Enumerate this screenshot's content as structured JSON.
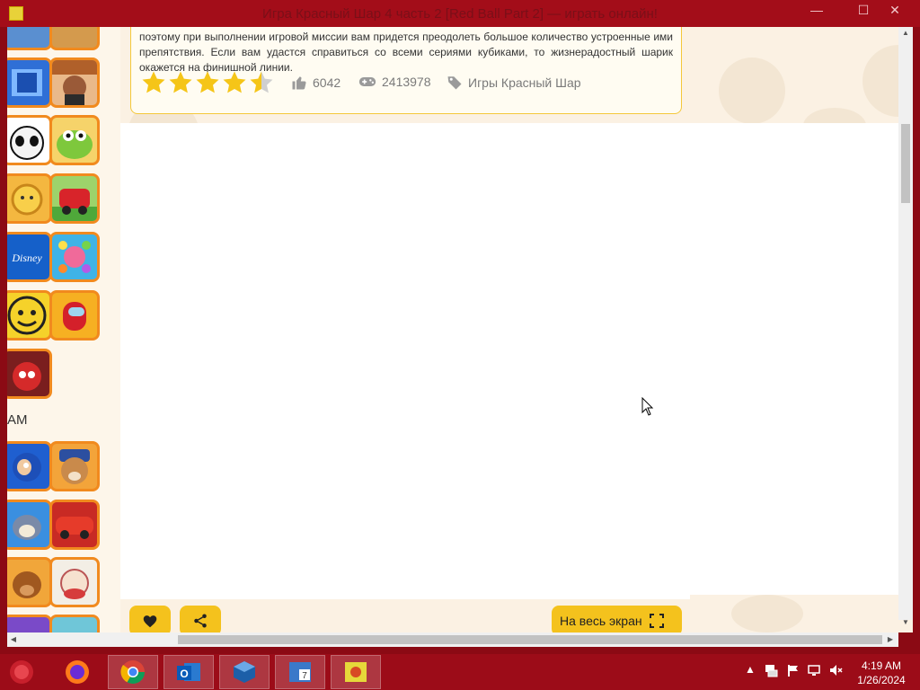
{
  "window": {
    "title": "Игра Красный Шар 4 часть 2 [Red Ball Part 2] — играть онлайн!",
    "min_label": "—",
    "max_label": "☐",
    "close_label": "✕"
  },
  "sidebar": {
    "section_label": "АМ"
  },
  "card": {
    "description": "поэтому при выполнении игровой миссии вам придется преодолеть большое количество устроенные ими препятствия. Если вам удастся справиться со всеми сериями кубиками, то жизнерадостный шарик окажется на финишной линии.",
    "rating": 4.5,
    "likes": "6042",
    "plays": "2413978",
    "category": "Игры Красный Шар"
  },
  "buttons": {
    "fullscreen": "На весь экран"
  },
  "taskbar": {
    "time": "4:19 AM",
    "date": "1/26/2024"
  },
  "colors": {
    "accent": "#f4c21d",
    "thumb_border": "#f18a1e",
    "titlebar": "#a30d19"
  }
}
